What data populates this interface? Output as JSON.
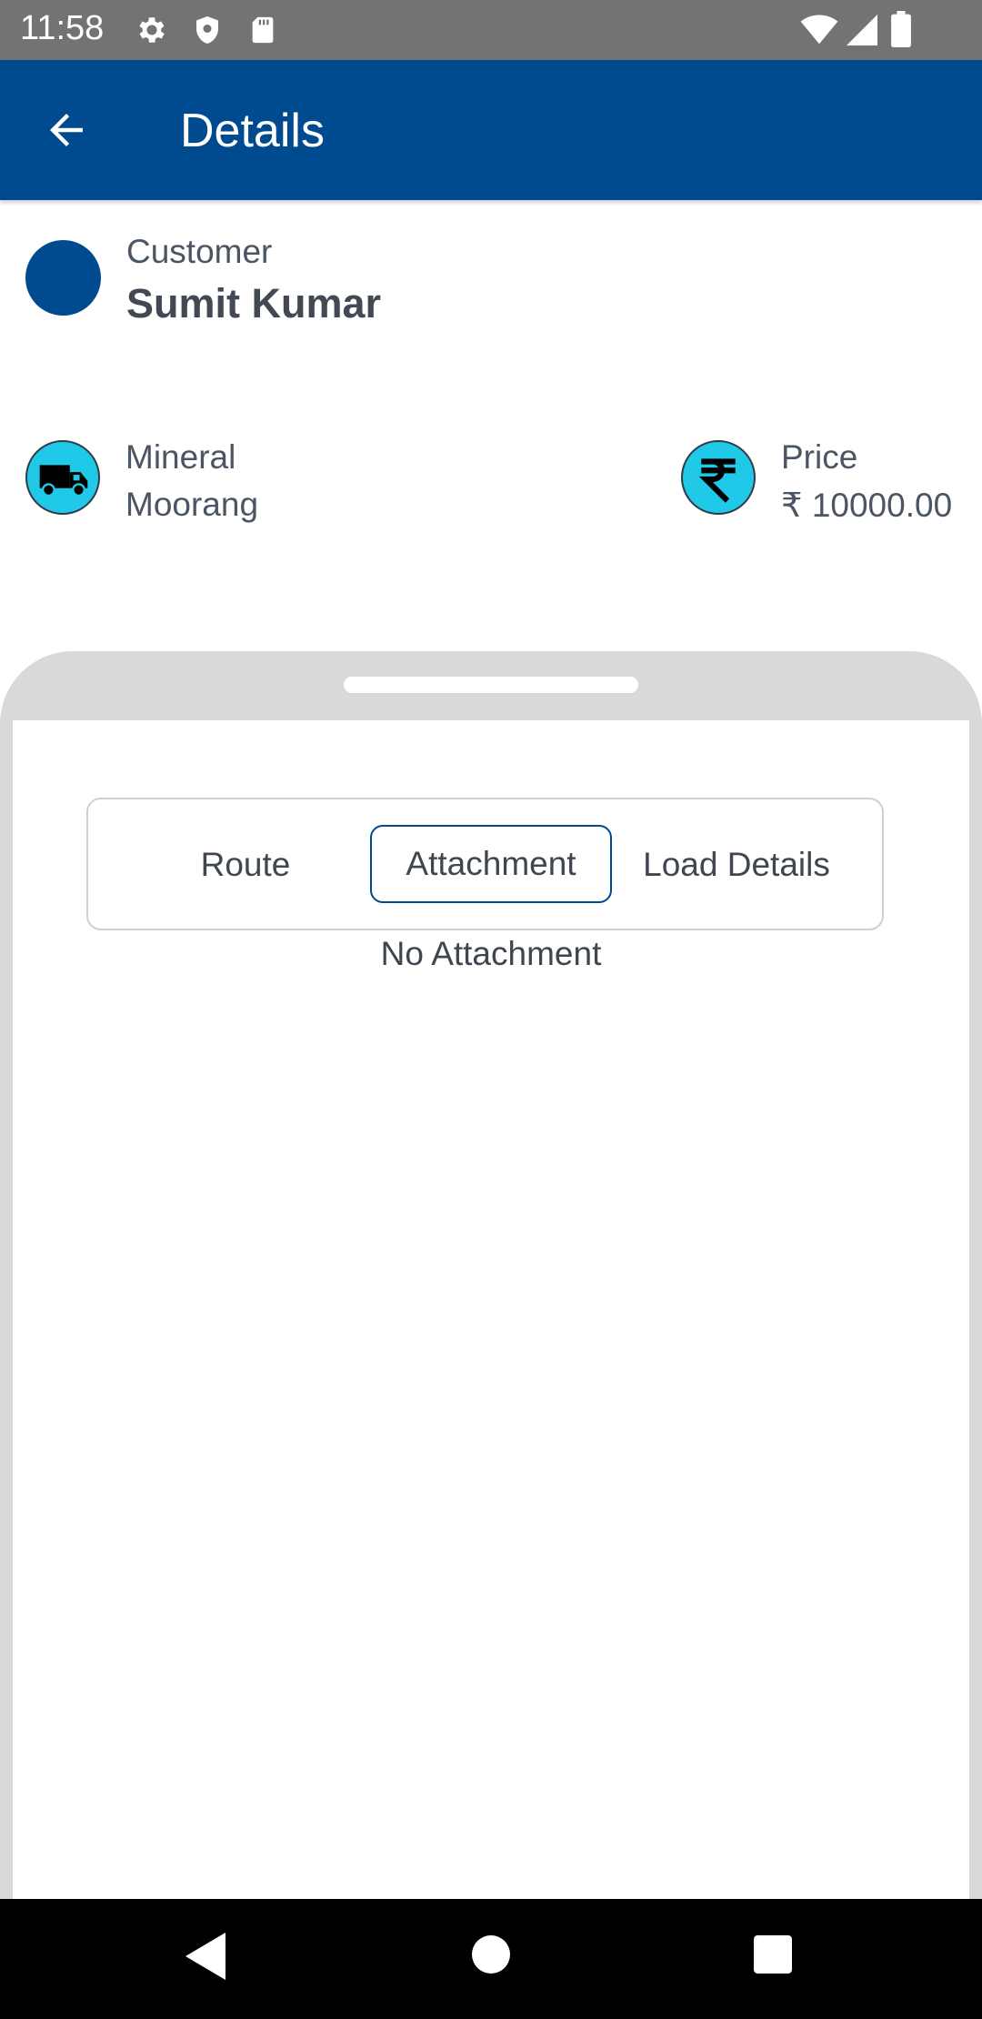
{
  "status_bar": {
    "time": "11:58",
    "icons": [
      "settings-icon",
      "shield-icon",
      "sd-card-icon",
      "wifi-icon",
      "signal-icon",
      "battery-icon"
    ]
  },
  "app_bar": {
    "title": "Details",
    "back_icon": "arrow-left-icon",
    "color": "#004a8f"
  },
  "customer": {
    "label": "Customer",
    "name": "Sumit Kumar"
  },
  "mineral": {
    "icon": "truck-icon",
    "label": "Mineral",
    "value": "Moorang"
  },
  "price": {
    "icon": "rupee-icon",
    "label": "Price",
    "value": "₹ 10000.00"
  },
  "tabs": {
    "items": [
      {
        "label": "Route"
      },
      {
        "label": "Attachment"
      },
      {
        "label": "Load Details"
      }
    ],
    "selected": "Attachment"
  },
  "attachment": {
    "empty_text": "No Attachment"
  },
  "nav_bar": {
    "icons": [
      "back-triangle-icon",
      "home-circle-icon",
      "recents-square-icon"
    ]
  },
  "colors": {
    "primary": "#004a8f",
    "icon_accent": "#21c9e8",
    "sheet_background": "#d9d9d9"
  }
}
